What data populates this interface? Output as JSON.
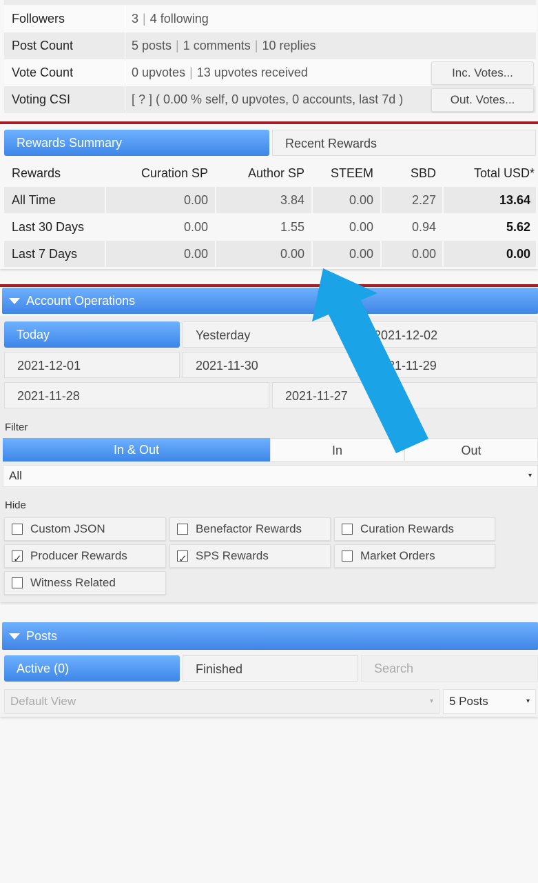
{
  "stats": {
    "rows": [
      {
        "label": "Followers",
        "value_parts": [
          "3",
          "4 following"
        ]
      },
      {
        "label": "Post Count",
        "value_parts": [
          "5 posts",
          "1 comments",
          "10 replies"
        ]
      },
      {
        "label": "Vote Count",
        "value_parts": [
          "0 upvotes",
          "13 upvotes received"
        ],
        "button": "Inc. Votes..."
      },
      {
        "label": "Voting CSI",
        "value_parts": [
          "[ ? ] ( 0.00 % self, 0 upvotes, 0 accounts, last 7d )"
        ],
        "button": "Out. Votes..."
      }
    ]
  },
  "rewards": {
    "tabs": [
      "Rewards Summary",
      "Recent Rewards"
    ],
    "headers": [
      "Rewards",
      "Curation SP",
      "Author SP",
      "STEEM",
      "SBD",
      "Total USD*"
    ],
    "rows": [
      [
        "All Time",
        "0.00",
        "3.84",
        "0.00",
        "2.27",
        "13.64"
      ],
      [
        "Last 30 Days",
        "0.00",
        "1.55",
        "0.00",
        "0.94",
        "5.62"
      ],
      [
        "Last 7 Days",
        "0.00",
        "0.00",
        "0.00",
        "0.00",
        "0.00"
      ]
    ]
  },
  "operations": {
    "title": "Account Operations",
    "days": [
      "Today",
      "Yesterday",
      "2021-12-02",
      "2021-12-01",
      "2021-11-30",
      "2021-11-29",
      "2021-11-28",
      "2021-11-27"
    ],
    "filter_label": "Filter",
    "filter_tabs": [
      "In & Out",
      "In",
      "Out"
    ],
    "filter_select": "All",
    "hide_label": "Hide",
    "hide_options": [
      {
        "label": "Custom JSON",
        "checked": false
      },
      {
        "label": "Benefactor Rewards",
        "checked": false
      },
      {
        "label": "Curation Rewards",
        "checked": false
      },
      {
        "label": "Producer Rewards",
        "checked": true
      },
      {
        "label": "SPS Rewards",
        "checked": true
      },
      {
        "label": "Market Orders",
        "checked": false
      },
      {
        "label": "Witness Related",
        "checked": false
      }
    ]
  },
  "posts": {
    "title": "Posts",
    "tabs": [
      "Active (0)",
      "Finished"
    ],
    "search_placeholder": "Search",
    "view_select": "Default View",
    "count_select": "5 Posts"
  },
  "colors": {
    "accent": "#4a90ef",
    "divider": "#a31d24",
    "arrow": "#1aa3e6"
  }
}
